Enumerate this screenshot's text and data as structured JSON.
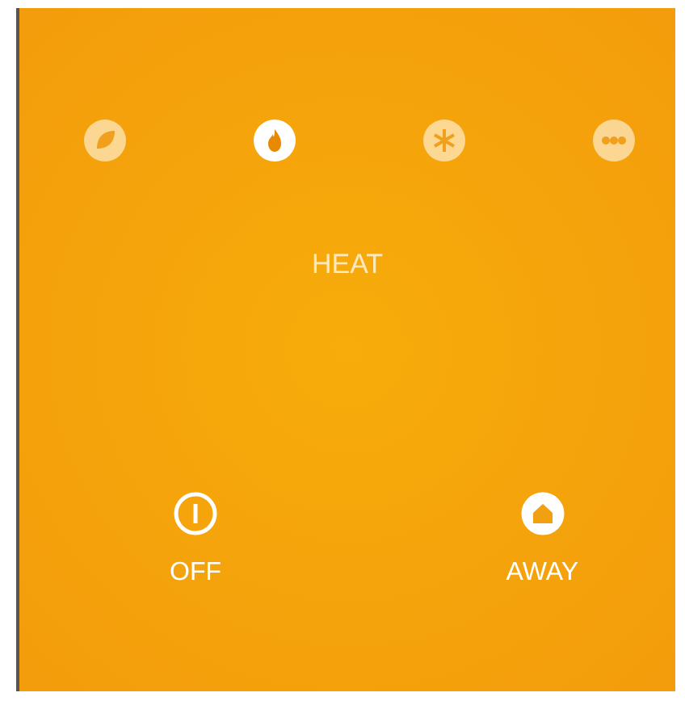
{
  "modes": [
    {
      "kind": "leaf",
      "selected": false
    },
    {
      "kind": "flame",
      "selected": true
    },
    {
      "kind": "snowflake",
      "selected": false
    },
    {
      "kind": "auto",
      "selected": false
    }
  ],
  "mode_label": "HEAT",
  "actions": [
    {
      "kind": "power",
      "label": "OFF",
      "on": false
    },
    {
      "kind": "home",
      "label": "AWAY",
      "on": true
    }
  ]
}
